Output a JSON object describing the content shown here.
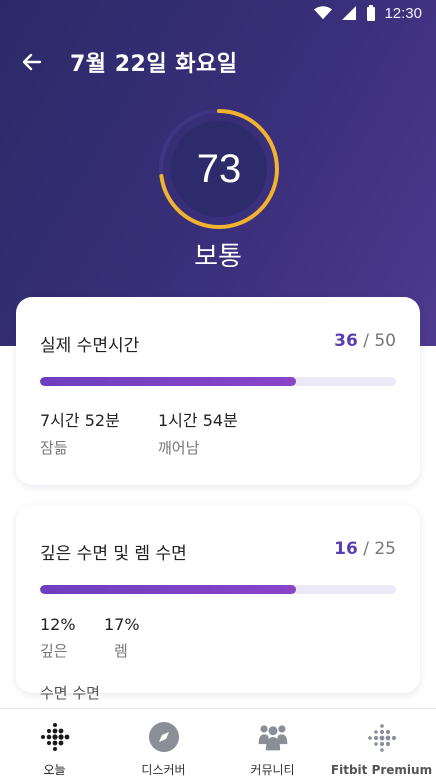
{
  "status": {
    "time": "12:30"
  },
  "header": {
    "date_title": "7월 22일 화요일"
  },
  "score": {
    "value": "73",
    "label": "보통",
    "progress_fraction": 0.73
  },
  "colors": {
    "accent_ring": "#f2b32e",
    "bar": "#7a42c4",
    "score_number": "#5a3fb0"
  },
  "cards": [
    {
      "title": "실제 수면시간",
      "score": "36",
      "max": "/ 50",
      "progress_fraction": 0.72,
      "stats": [
        {
          "value": "7시간 52분",
          "label": "잠듦"
        },
        {
          "value": "1시간 54분",
          "label": "깨어남"
        }
      ]
    },
    {
      "title": "깊은 수면 및 렘 수면",
      "score": "16",
      "max": "/ 25",
      "progress_fraction": 0.72,
      "stats": [
        {
          "value": "12%",
          "label": "깊은"
        },
        {
          "value": "17%",
          "label": "렘"
        }
      ],
      "cutoff_text": "수면      수면"
    }
  ],
  "nav": [
    {
      "label": "오늘",
      "icon": "fitbit-dots-icon"
    },
    {
      "label": "디스커버",
      "icon": "compass-icon"
    },
    {
      "label": "커뮤니티",
      "icon": "community-icon"
    },
    {
      "label": "Fitbit Premium",
      "icon": "fitbit-premium-icon"
    }
  ]
}
